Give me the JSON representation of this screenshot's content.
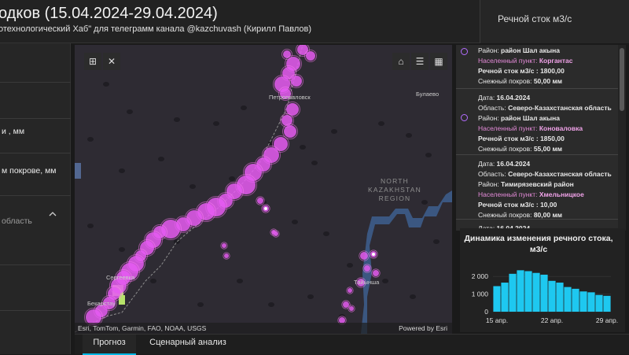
{
  "header": {
    "title": "одков (15.04.2024-29.04.2024)",
    "subtitle": "отехнологический Хаб\" для телеграмм канала @kazchuvash (Кирилл Павлов)",
    "right_label": "Речной сток м3/с"
  },
  "sidebar": {
    "items": [
      {
        "label": "и , мм"
      },
      {
        "label": "м покрове, мм"
      },
      {
        "label": "область"
      }
    ]
  },
  "map": {
    "cities": [
      {
        "label": "Петропавловск"
      },
      {
        "label": "Булаево"
      },
      {
        "label": "Сергеевка"
      },
      {
        "label": "Тайынша"
      },
      {
        "label": "Бекарстау"
      }
    ],
    "region_label": "NORTH\nKAZAKHSTAN\nREGION",
    "attribution_left": "Esri, TomTom, Garmin, FAO, NOAA, USGS",
    "attribution_right": "Powered by Esri",
    "controls": {
      "basemap_icon": "grid-select-icon",
      "close_icon": "close-icon",
      "home_icon": "home-icon",
      "list_icon": "list-icon",
      "qr_icon": "qr-icon"
    },
    "colors": {
      "river_point": "#e65cf2",
      "region_fill": "#3d5f8f",
      "background": "#2e2b33"
    }
  },
  "popup": {
    "entries": [
      {
        "lines": [
          {
            "label": "Район:",
            "value": "район Шал акына"
          },
          {
            "label": "Населенный пункт:",
            "value": "Коргантас",
            "kind": "town"
          },
          {
            "label": "Речной сток м3/с :",
            "value": "1800,00",
            "kind": "bold"
          },
          {
            "label": "Снежный покров:",
            "value": "50,00 мм"
          }
        ]
      },
      {
        "lines": [
          {
            "label": "Дата:",
            "value": "16.04.2024"
          },
          {
            "label": "Область:",
            "value": "Северо-Казахстанская область"
          },
          {
            "label": "Район:",
            "value": "район Шал акына"
          },
          {
            "label": "Населенный пункт:",
            "value": "Коноваловка",
            "kind": "town"
          },
          {
            "label": "Речной сток м3/с :",
            "value": "1850,00",
            "kind": "bold"
          },
          {
            "label": "Снежный покров:",
            "value": "55,00 мм"
          }
        ]
      },
      {
        "lines": [
          {
            "label": "Дата:",
            "value": "16.04.2024"
          },
          {
            "label": "Область:",
            "value": "Северо-Казахстанская область"
          },
          {
            "label": "Район:",
            "value": "Тимирязевский район"
          },
          {
            "label": "Населенный пункт:",
            "value": "Хмельницкое",
            "kind": "town"
          },
          {
            "label": "Речной сток м3/с :",
            "value": "10,00",
            "kind": "bold"
          },
          {
            "label": "Снежный покров:",
            "value": "80,00 мм"
          }
        ]
      },
      {
        "lines": [
          {
            "label": "Дата:",
            "value": "16.04.2024"
          }
        ]
      }
    ]
  },
  "chart_data": {
    "type": "bar",
    "title": "Динамика изменения речного стока, м3/с",
    "x": [
      "15.04",
      "16.04",
      "17.04",
      "18.04",
      "19.04",
      "20.04",
      "21.04",
      "22.04",
      "23.04",
      "24.04",
      "25.04",
      "26.04",
      "27.04",
      "28.04",
      "29.04"
    ],
    "values": [
      1450,
      1650,
      2150,
      2350,
      2300,
      2200,
      2100,
      1750,
      1650,
      1400,
      1300,
      1150,
      1100,
      950,
      900
    ],
    "xticks": [
      "15 апр.",
      "22 апр.",
      "29 апр."
    ],
    "yticks": [
      "0",
      "1 000",
      "2 000"
    ],
    "ylim": [
      0,
      2500
    ],
    "color": "#1ec8f0"
  },
  "tabs": [
    {
      "label": "Прогноз",
      "active": true
    },
    {
      "label": "Сценарный анализ",
      "active": false
    }
  ]
}
